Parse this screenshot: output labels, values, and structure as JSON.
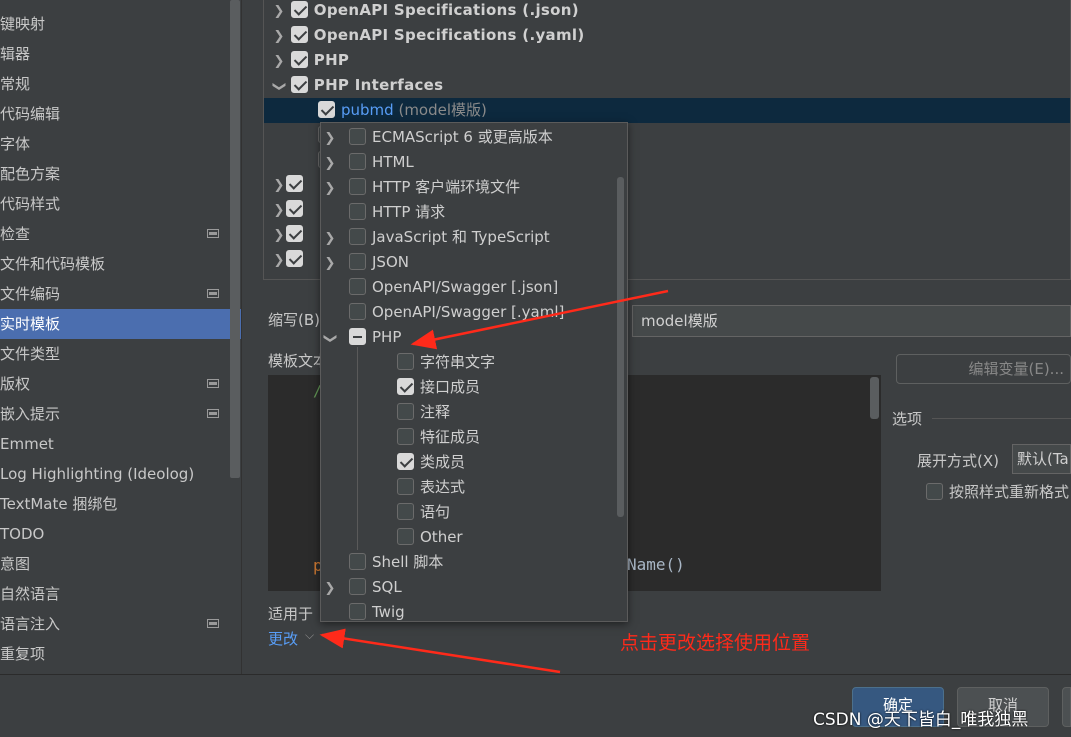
{
  "sidebar": {
    "items": [
      {
        "label": "键映射",
        "modified": false,
        "selected": false
      },
      {
        "label": "辑器",
        "modified": false,
        "selected": false
      },
      {
        "label": "常规",
        "modified": false,
        "selected": false
      },
      {
        "label": "代码编辑",
        "modified": false,
        "selected": false
      },
      {
        "label": "字体",
        "modified": false,
        "selected": false
      },
      {
        "label": "配色方案",
        "modified": false,
        "selected": false
      },
      {
        "label": "代码样式",
        "modified": false,
        "selected": false
      },
      {
        "label": "检查",
        "modified": true,
        "selected": false
      },
      {
        "label": "文件和代码模板",
        "modified": false,
        "selected": false
      },
      {
        "label": "文件编码",
        "modified": true,
        "selected": false
      },
      {
        "label": "实时模板",
        "modified": false,
        "selected": true
      },
      {
        "label": "文件类型",
        "modified": false,
        "selected": false
      },
      {
        "label": "版权",
        "modified": true,
        "selected": false
      },
      {
        "label": "嵌入提示",
        "modified": true,
        "selected": false
      },
      {
        "label": "Emmet",
        "modified": false,
        "selected": false
      },
      {
        "label": "Log Highlighting (Ideolog)",
        "modified": false,
        "selected": false
      },
      {
        "label": "TextMate 捆绑包",
        "modified": false,
        "selected": false
      },
      {
        "label": "TODO",
        "modified": false,
        "selected": false
      },
      {
        "label": "意图",
        "modified": false,
        "selected": false
      },
      {
        "label": "自然语言",
        "modified": false,
        "selected": false
      },
      {
        "label": "语言注入",
        "modified": true,
        "selected": false
      },
      {
        "label": "重复项",
        "modified": false,
        "selected": false
      }
    ]
  },
  "template_tree": {
    "groups": [
      {
        "label": "OpenAPI Specifications (.json)",
        "checked": true,
        "expanded": false
      },
      {
        "label": "OpenAPI Specifications (.yaml)",
        "checked": true,
        "expanded": false
      },
      {
        "label": "PHP",
        "checked": true,
        "expanded": false
      },
      {
        "label": "PHP Interfaces",
        "checked": true,
        "expanded": true
      }
    ],
    "selected_template": {
      "name": "pubmd",
      "description": "(model模版)",
      "checked": true
    },
    "collapsed_rows_checked": [
      true,
      true,
      true,
      true
    ]
  },
  "abbreviation": {
    "label": "缩写(B)",
    "description_value": "model模版"
  },
  "template_text": {
    "label": "模板文本",
    "code_comment": "/",
    "code_keyword": "p",
    "code_tail": "Name()"
  },
  "edit_variables_button": "编辑变量(E)...",
  "options": {
    "title": "选项",
    "expand_label": "展开方式(X)",
    "expand_value": "默认(Ta",
    "reformat_label": "按照样式重新格式",
    "reformat_checked": false
  },
  "applies_to": {
    "label": "适用于",
    "change_link": "更改"
  },
  "popup": {
    "items": [
      {
        "label": "ECMAScript 6 或更高版本",
        "state": "off",
        "level": 0,
        "arrow": "right"
      },
      {
        "label": "HTML",
        "state": "off",
        "level": 0,
        "arrow": "right"
      },
      {
        "label": "HTTP 客户端环境文件",
        "state": "off",
        "level": 0,
        "arrow": "right"
      },
      {
        "label": "HTTP 请求",
        "state": "off",
        "level": 0,
        "arrow": "none"
      },
      {
        "label": "JavaScript 和 TypeScript",
        "state": "off",
        "level": 0,
        "arrow": "right"
      },
      {
        "label": "JSON",
        "state": "off",
        "level": 0,
        "arrow": "right"
      },
      {
        "label": "OpenAPI/Swagger [.json]",
        "state": "off",
        "level": 0,
        "arrow": "none"
      },
      {
        "label": "OpenAPI/Swagger [.yaml]",
        "state": "off",
        "level": 0,
        "arrow": "none"
      },
      {
        "label": "PHP",
        "state": "mixed",
        "level": 0,
        "arrow": "down"
      },
      {
        "label": "字符串文字",
        "state": "off",
        "level": 1,
        "arrow": "none"
      },
      {
        "label": "接口成员",
        "state": "on",
        "level": 1,
        "arrow": "none"
      },
      {
        "label": "注释",
        "state": "off",
        "level": 1,
        "arrow": "none"
      },
      {
        "label": "特征成员",
        "state": "off",
        "level": 1,
        "arrow": "none"
      },
      {
        "label": "类成员",
        "state": "on",
        "level": 1,
        "arrow": "none"
      },
      {
        "label": "表达式",
        "state": "off",
        "level": 1,
        "arrow": "none"
      },
      {
        "label": "语句",
        "state": "off",
        "level": 1,
        "arrow": "none"
      },
      {
        "label": "Other",
        "state": "off",
        "level": 1,
        "arrow": "none"
      },
      {
        "label": "Shell 脚本",
        "state": "off",
        "level": 0,
        "arrow": "none"
      },
      {
        "label": "SQL",
        "state": "off",
        "level": 0,
        "arrow": "right"
      },
      {
        "label": "Twig",
        "state": "off",
        "level": 0,
        "arrow": "none"
      }
    ]
  },
  "buttons": {
    "ok": "确定",
    "cancel": "取消"
  },
  "annotation": {
    "text": "点击更改选择使用位置",
    "color": "#ff2a1a"
  },
  "watermark": "CSDN @天下皆白_唯我独黑"
}
